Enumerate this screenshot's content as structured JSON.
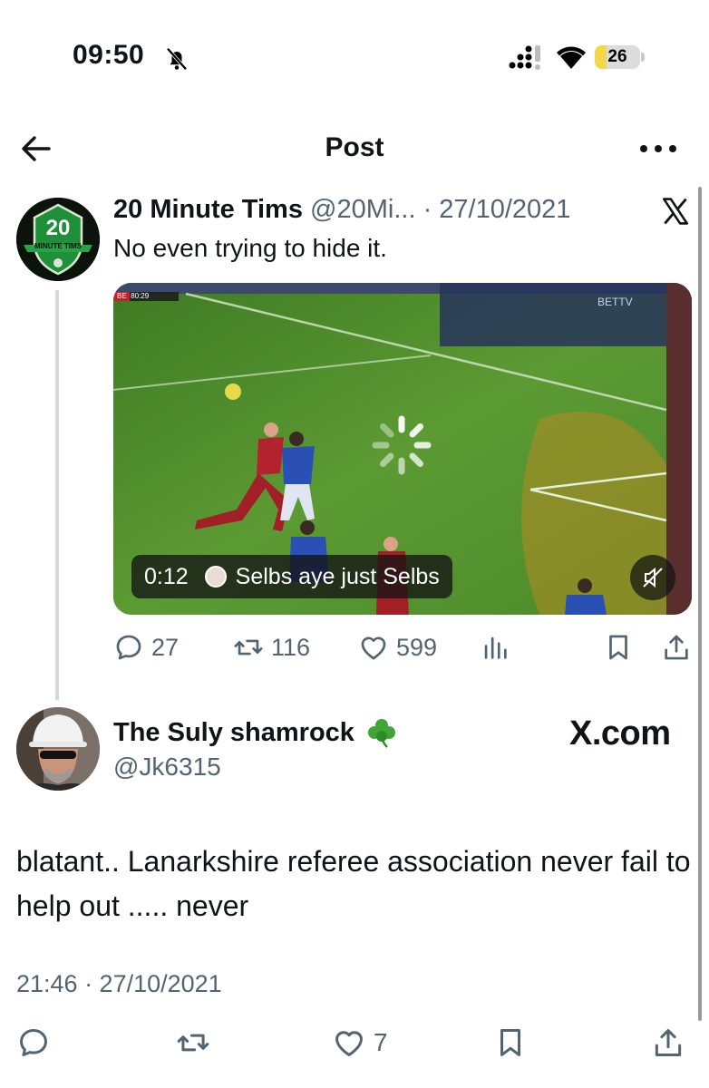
{
  "status_bar": {
    "time": "09:50",
    "battery": "26",
    "battery_level": 0.26,
    "icons": [
      "bell-slash-icon",
      "signal-icon",
      "wifi-icon",
      "battery-icon"
    ]
  },
  "header": {
    "title": "Post",
    "icons": [
      "back-arrow-icon",
      "more-icon"
    ]
  },
  "original_post": {
    "author_name": "20 Minute Tims",
    "handle": "@20Mi...",
    "separator": "·",
    "date": "27/10/2021",
    "text": "No even trying to hide it.",
    "avatar_text": "20",
    "avatar_banner": "MINUTE TIMS",
    "video": {
      "duration": "0:12",
      "caption": "Selbs aye just Selbs",
      "scoreboard": "BE  80:29",
      "broadcaster": "BETTV"
    },
    "stats": {
      "replies": "27",
      "reposts": "116",
      "likes": "599"
    },
    "icons": [
      "x-logo-icon",
      "reply-icon",
      "repost-icon",
      "like-icon",
      "views-icon",
      "bookmark-icon",
      "share-icon",
      "spinner-icon",
      "mute-icon"
    ]
  },
  "reply_post": {
    "author_name": "The Suly shamrock",
    "handle": "@Jk6315",
    "watermark": "X.com",
    "text": "blatant..   Lanarkshire referee association never fail to help out ..... never",
    "timestamp": "21:46 · 27/10/2021",
    "stats": {
      "likes": "7"
    },
    "icons": [
      "shamrock-icon",
      "reply-icon",
      "repost-icon",
      "like-icon",
      "bookmark-icon",
      "share-icon"
    ]
  },
  "colors": {
    "text": "#0f1419",
    "secondary": "#536471",
    "thread_line": "#cfd9de",
    "pitch": "#4f8a2c",
    "battery_fill": "#f3d64a"
  }
}
